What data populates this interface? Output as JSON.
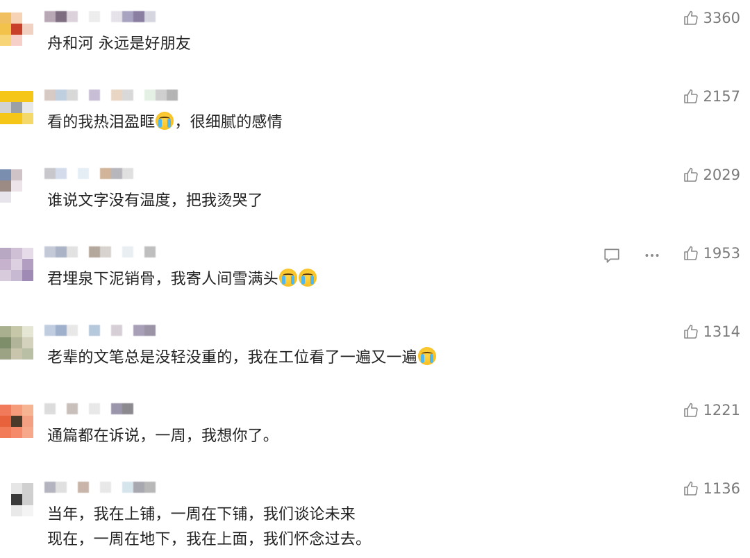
{
  "comments": [
    {
      "lines": [
        "舟和河 永远是好朋友"
      ],
      "likes": "3360",
      "avatar": [
        "#f0c060",
        "#f6d3b4",
        "#ffffff",
        "#f3c24a",
        "#c8402a",
        "#f1d2c2",
        "#f7d577",
        "#f6d0c8",
        "#ffffff"
      ],
      "name_blocks": [
        "#b8a8b6",
        "#7e6d80",
        "#dcd2dc",
        "#ffffff",
        "#ededed",
        "#ffffff",
        "#e6e2ea",
        "#a8a3c0",
        "#8a7fa0",
        "#d6d6e0"
      ]
    },
    {
      "lines": [
        "看的我热泪盈眶{emoji}，很细腻的感情"
      ],
      "likes": "2157",
      "avatar": [
        "#f5c518",
        "#f5c518",
        "#f5c518",
        "#d2d2d2",
        "#9aa0a6",
        "#e8e8e8",
        "#f5c518",
        "#f5c518",
        "#f5d86a"
      ],
      "name_blocks": [
        "#d7c9c4",
        "#bfcfe0",
        "#d8d8d8",
        "#ffffff",
        "#c8bfd6",
        "#ffffff",
        "#e8d5c4",
        "#d9d9d9",
        "#ffffff",
        "#e5f0e5",
        "#cfcfcf",
        "#b4b4b4"
      ]
    },
    {
      "lines": [
        "谁说文字没有温度，把我烫哭了"
      ],
      "likes": "2029",
      "avatar": [
        "#7a8fb0",
        "#cfc3c8",
        "#ffffff",
        "#9c8a85",
        "#ece4e8",
        "#ffffff",
        "#e8e4ec",
        "#ffffff",
        "#ffffff"
      ],
      "name_blocks": [
        "#c7c7cc",
        "#d4dcec",
        "#ffffff",
        "#e6eef5",
        "#ffffff",
        "#d2b49a",
        "#b6b6bc",
        "#e0e0e0"
      ]
    },
    {
      "lines": [
        "君埋泉下泥销骨，我寄人间雪满头{emoji}{emoji}"
      ],
      "likes": "1953",
      "show_actions": true,
      "avatar": [
        "#b9a8c4",
        "#cfc0d6",
        "#e6dbe9",
        "#c6b2cc",
        "#ddd0e0",
        "#b29ec0",
        "#d8ccdc",
        "#c7b9d1",
        "#9f8ab6"
      ],
      "name_blocks": [
        "#c4c9d8",
        "#aab4c6",
        "#e2e2e2",
        "#ffffff",
        "#b4a89c",
        "#d8d3ce",
        "#ffffff",
        "#e8eef2",
        "#ffffff",
        "#bfbfbf"
      ]
    },
    {
      "lines": [
        "老辈的文笔总是没轻没重的，我在工位看了一遍又一遍{emoji}"
      ],
      "likes": "1314",
      "avatar": [
        "#a9b090",
        "#c6c6a8",
        "#e6e6d4",
        "#7e8e6a",
        "#b2b49a",
        "#d4d2bc",
        "#9ca284",
        "#c9c5ac",
        "#b8bfa4"
      ],
      "name_blocks": [
        "#c0cde0",
        "#9fb0cc",
        "#e8e8e8",
        "#ffffff",
        "#b6c8dc",
        "#ffffff",
        "#d6d0d6",
        "#ffffff",
        "#a8a0b8",
        "#9a94a6"
      ]
    },
    {
      "lines": [
        "通篇都在诉说，一周，我想你了。"
      ],
      "likes": "1221",
      "avatar": [
        "#f07a5a",
        "#f59b7a",
        "#f7b493",
        "#e8623c",
        "#4a3a2a",
        "#f29f82",
        "#f27c58",
        "#f58a6a",
        "#f7a88a"
      ],
      "name_blocks": [
        "#dcdcdc",
        "#ffffff",
        "#c9c0bc",
        "#ffffff",
        "#e8e8e8",
        "#ffffff",
        "#9a95aa",
        "#8c8a8e"
      ]
    },
    {
      "lines": [
        "当年，我在上铺，一周在下铺，我们谈论未来",
        "现在，一周在地下，我在上面，我们怀念过去。"
      ],
      "likes": "1136",
      "avatar": [
        "#ffffff",
        "#e6e6e6",
        "#d0d0d0",
        "#ffffff",
        "#3a3a3a",
        "#cfcfcf",
        "#ffffff",
        "#e9e9e9",
        "#f4f4f4"
      ],
      "name_blocks": [
        "#b4b4c0",
        "#e0e0e0",
        "#ffffff",
        "#c8b4a8",
        "#ffffff",
        "#e8e8e8",
        "#ffffff",
        "#d6e4ec",
        "#a8a8b0",
        "#b8b8b8"
      ]
    }
  ]
}
